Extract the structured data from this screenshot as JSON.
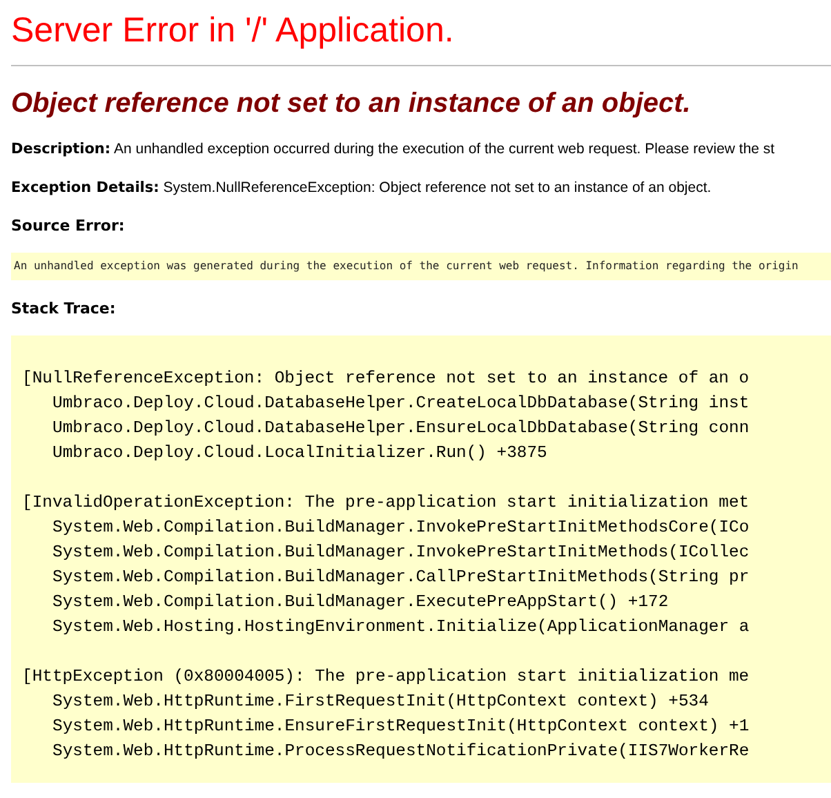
{
  "title": "Server Error in '/' Application.",
  "error_message": "Object reference not set to an instance of an object.",
  "details": [
    {
      "label": "Description:",
      "text": "An unhandled exception occurred during the execution of the current web request. Please review the st"
    },
    {
      "label": "Exception Details:",
      "text": "System.NullReferenceException: Object reference not set to an instance of an object."
    }
  ],
  "source_error": {
    "heading": "Source Error:",
    "text": "An unhandled exception was generated during the execution of the current web request. Information regarding the origin"
  },
  "stack_trace": {
    "heading": "Stack Trace:",
    "groups": [
      {
        "exception": "[NullReferenceException: Object reference not set to an instance of an o",
        "frames": [
          "Umbraco.Deploy.Cloud.DatabaseHelper.CreateLocalDbDatabase(String inst",
          "Umbraco.Deploy.Cloud.DatabaseHelper.EnsureLocalDbDatabase(String conn",
          "Umbraco.Deploy.Cloud.LocalInitializer.Run() +3875"
        ]
      },
      {
        "exception": "[InvalidOperationException: The pre-application start initialization met",
        "frames": [
          "System.Web.Compilation.BuildManager.InvokePreStartInitMethodsCore(ICo",
          "System.Web.Compilation.BuildManager.InvokePreStartInitMethods(ICollec",
          "System.Web.Compilation.BuildManager.CallPreStartInitMethods(String pr",
          "System.Web.Compilation.BuildManager.ExecutePreAppStart() +172",
          "System.Web.Hosting.HostingEnvironment.Initialize(ApplicationManager a"
        ]
      },
      {
        "exception": "[HttpException (0x80004005): The pre-application start initialization me",
        "frames": [
          "System.Web.HttpRuntime.FirstRequestInit(HttpContext context) +534",
          "System.Web.HttpRuntime.EnsureFirstRequestInit(HttpContext context) +1",
          "System.Web.HttpRuntime.ProcessRequestNotificationPrivate(IIS7WorkerRe"
        ]
      }
    ]
  }
}
